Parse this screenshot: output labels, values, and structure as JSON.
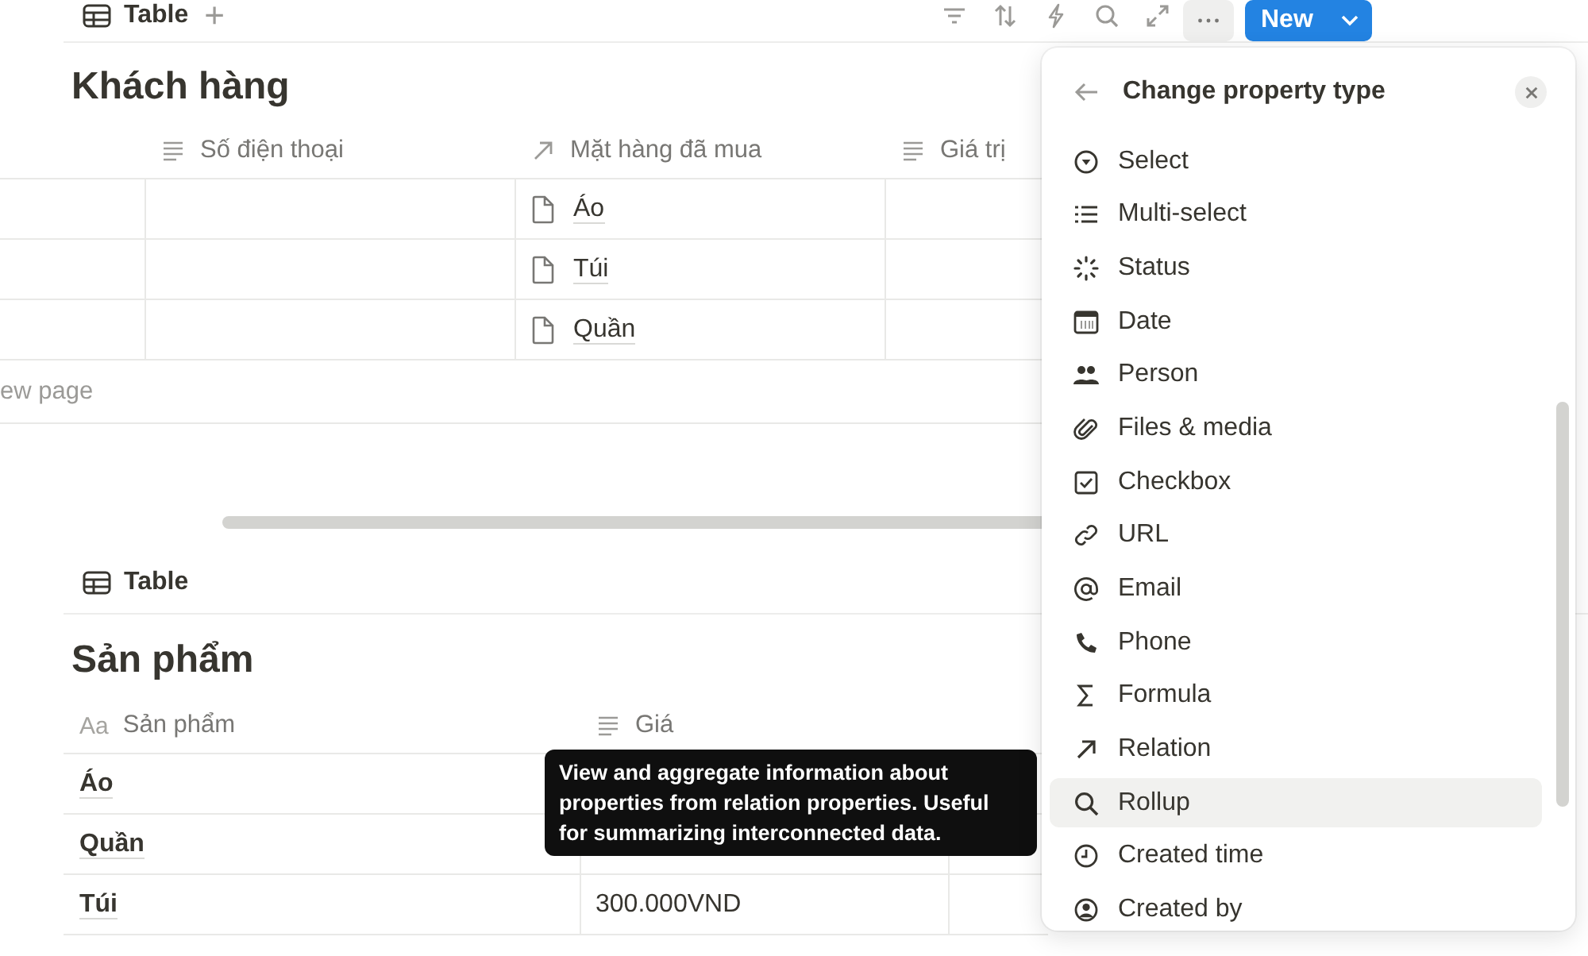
{
  "toolbar": {
    "view_tab": "Table",
    "add": "+",
    "new_button": "New"
  },
  "customers": {
    "title": "Khách hàng",
    "columns": [
      {
        "label": "Số điện thoại",
        "kind": "text"
      },
      {
        "label": "Mặt hàng đã mua",
        "kind": "relation"
      },
      {
        "label": "Giá trị",
        "kind": "text"
      }
    ],
    "rows": [
      {
        "item": "Áo"
      },
      {
        "item": "Túi"
      },
      {
        "item": "Quần"
      }
    ],
    "new_page": "ew page"
  },
  "products": {
    "view_tab": "Table",
    "title": "Sản phẩm",
    "columns": [
      {
        "label": "Sản phẩm",
        "kind": "title",
        "icon_text": "Aa"
      },
      {
        "label": "Giá",
        "kind": "text"
      }
    ],
    "rows": [
      {
        "name": "Áo"
      },
      {
        "name": "Quần"
      },
      {
        "name": "Túi",
        "price": "300.000VND"
      }
    ]
  },
  "tooltip": "View and aggregate information about properties from relation properties. Useful for summarizing interconnected data.",
  "menu": {
    "title": "Change property type",
    "items": [
      {
        "label": "Select",
        "kind": "select",
        "selected": false
      },
      {
        "label": "Multi-select",
        "kind": "multi",
        "selected": false
      },
      {
        "label": "Status",
        "kind": "status",
        "selected": false
      },
      {
        "label": "Date",
        "kind": "date",
        "selected": false
      },
      {
        "label": "Person",
        "kind": "person",
        "selected": false
      },
      {
        "label": "Files & media",
        "kind": "files",
        "selected": false
      },
      {
        "label": "Checkbox",
        "kind": "checkbox",
        "selected": false
      },
      {
        "label": "URL",
        "kind": "url",
        "selected": false
      },
      {
        "label": "Email",
        "kind": "email",
        "selected": false
      },
      {
        "label": "Phone",
        "kind": "phone",
        "selected": false
      },
      {
        "label": "Formula",
        "kind": "formula",
        "selected": false
      },
      {
        "label": "Relation",
        "kind": "relation",
        "selected": false
      },
      {
        "label": "Rollup",
        "kind": "rollup",
        "selected": true
      },
      {
        "label": "Created time",
        "kind": "time",
        "selected": false
      },
      {
        "label": "Created by",
        "kind": "creator",
        "selected": false
      }
    ]
  }
}
